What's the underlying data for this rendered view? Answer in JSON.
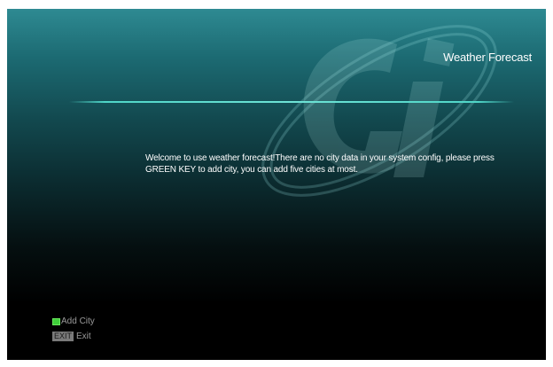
{
  "header": {
    "title": "Weather Forecast"
  },
  "logo": {
    "text": "Gi"
  },
  "main": {
    "message_line1": "Welcome to use weather forecast!There are no city data in your system config, please press",
    "message_line2": "GREEN KEY to add city, you can add five cities at most."
  },
  "legend": {
    "add_city": {
      "key_color": "#3fcf3a",
      "label": "Add City"
    },
    "exit": {
      "key_label": "EXIT",
      "label": "Exit"
    }
  }
}
